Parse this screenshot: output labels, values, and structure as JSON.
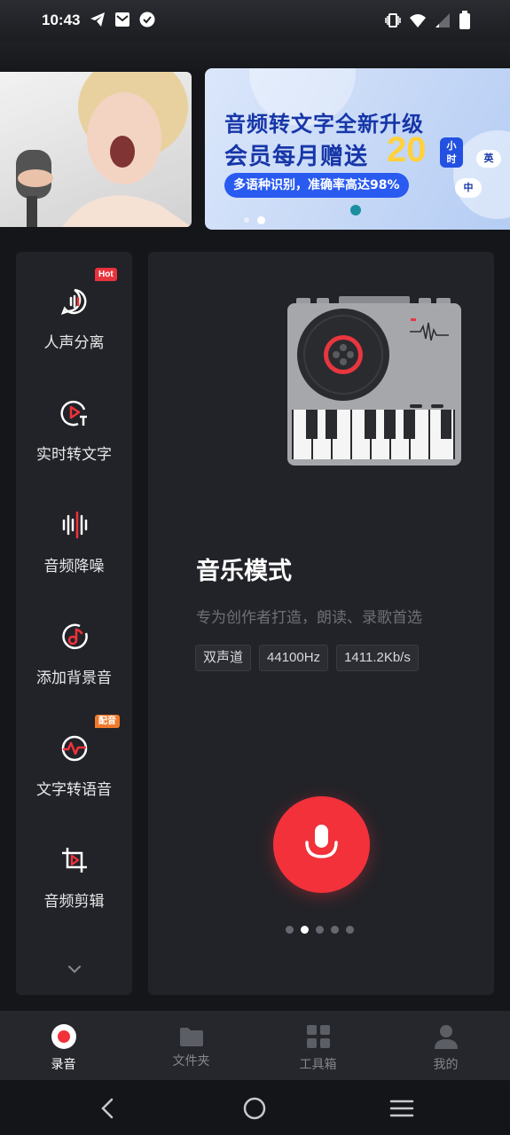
{
  "status_bar": {
    "time": "10:43",
    "icons_left": [
      "telegram-icon",
      "mail-icon",
      "check-circle-icon"
    ],
    "icons_right": [
      "vibrate-icon",
      "wifi-icon",
      "signal-icon",
      "battery-icon"
    ]
  },
  "banner": {
    "line1": "音频转文字全新升级",
    "line2": "会员每月赠送",
    "highlight_number": "20",
    "unit_line1": "小",
    "unit_line2": "时",
    "pill_text": "多语种识别，准确率高达98%",
    "side_chars": [
      "英",
      "中"
    ],
    "page_count": 2,
    "active_page": 2
  },
  "tools": [
    {
      "label": "人声分离",
      "icon": "voice-separate-icon",
      "badge": "Hot",
      "badge_color": "#e8323c"
    },
    {
      "label": "实时转文字",
      "icon": "realtime-text-icon",
      "badge": "",
      "badge_color": ""
    },
    {
      "label": "音频降噪",
      "icon": "denoise-icon",
      "badge": "",
      "badge_color": ""
    },
    {
      "label": "添加背景音",
      "icon": "music-note-icon",
      "badge": "",
      "badge_color": ""
    },
    {
      "label": "文字转语音",
      "icon": "tts-wave-icon",
      "badge": "配音",
      "badge_color": "#f07a2b"
    },
    {
      "label": "音频剪辑",
      "icon": "crop-play-icon",
      "badge": "",
      "badge_color": ""
    }
  ],
  "mode": {
    "title": "音乐模式",
    "description": "专为创作者打造，朗读、录歌首选",
    "tags": [
      "双声道",
      "44100Hz",
      "1411.2Kb/s"
    ],
    "pager_count": 5,
    "pager_active": 2
  },
  "bottom_nav": [
    {
      "label": "录音",
      "icon": "record-icon",
      "active": true
    },
    {
      "label": "文件夹",
      "icon": "folder-icon",
      "active": false
    },
    {
      "label": "工具箱",
      "icon": "grid-icon",
      "active": false
    },
    {
      "label": "我的",
      "icon": "profile-icon",
      "active": false
    }
  ],
  "colors": {
    "accent_red": "#f2313b",
    "panel_bg": "#222328",
    "banner_blue": "#1736a8",
    "banner_yellow": "#ffd13c"
  }
}
